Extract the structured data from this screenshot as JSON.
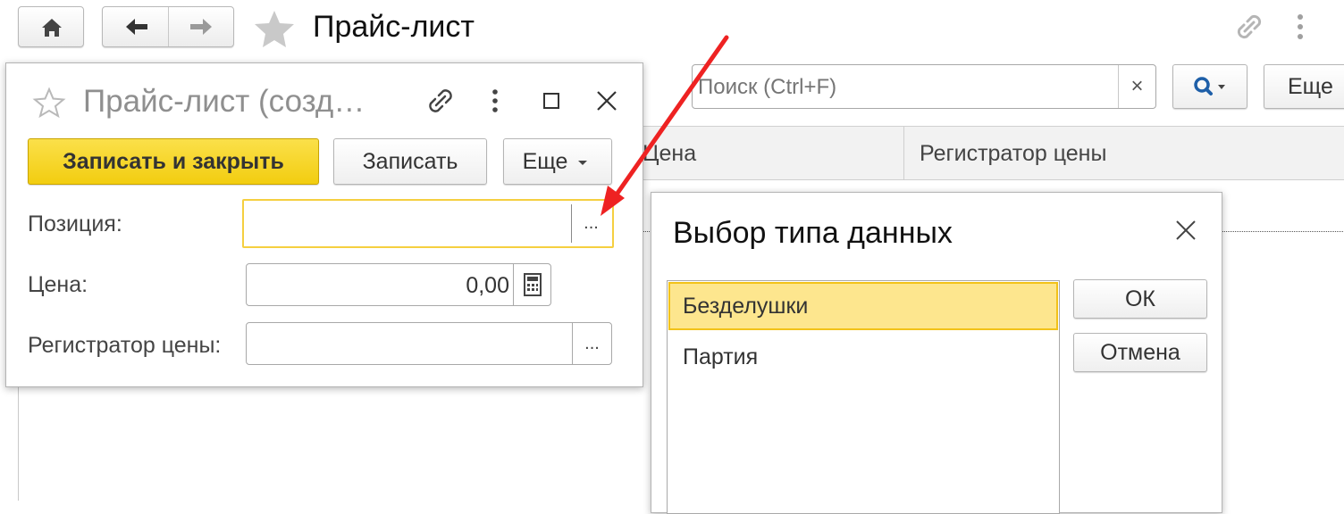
{
  "main": {
    "title": "Прайс-лист",
    "search": {
      "placeholder": "Поиск (Ctrl+F)",
      "clear_icon": "×"
    },
    "more_label": "Еще",
    "columns": [
      "Цена",
      "Регистратор цены"
    ]
  },
  "form": {
    "title": "Прайс-лист (созд…",
    "save_close_label": "Записать и закрыть",
    "save_label": "Записать",
    "more_label": "Еще",
    "fields": {
      "position": {
        "label": "Позиция:",
        "value": ""
      },
      "price": {
        "label": "Цена:",
        "value": "0,00"
      },
      "registrar": {
        "label": "Регистратор цены:",
        "value": ""
      }
    },
    "select_button_label": "..."
  },
  "dialog": {
    "title": "Выбор типа данных",
    "items": [
      "Безделушки",
      "Партия"
    ],
    "selected_index": 0,
    "ok_label": "ОК",
    "cancel_label": "Отмена"
  },
  "colors": {
    "accent_yellow": "#f9d814",
    "selection": "#fde68e",
    "arrow": "#ee2222"
  }
}
